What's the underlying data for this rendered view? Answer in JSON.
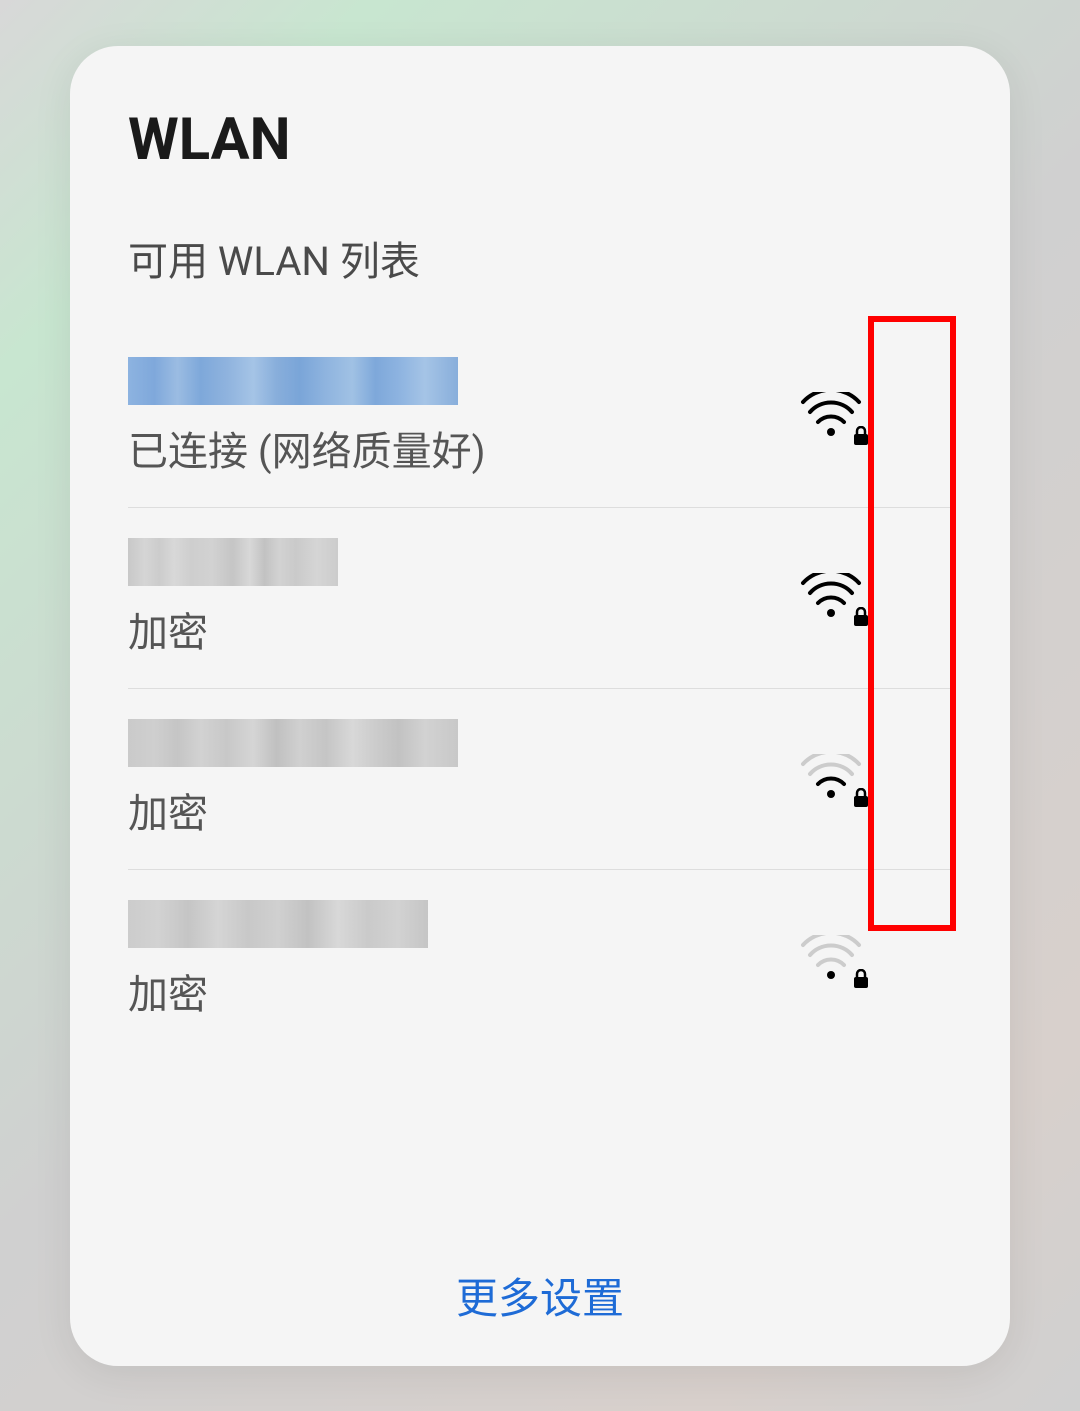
{
  "title": "WLAN",
  "subtitle": "可用 WLAN 列表",
  "networks": [
    {
      "status": "已连接 (网络质量好)",
      "signal": "strong",
      "locked": true,
      "nameStyle": "pixelated-blue"
    },
    {
      "status": "加密",
      "signal": "strong",
      "locked": true,
      "nameStyle": "pixelated-gray1"
    },
    {
      "status": "加密",
      "signal": "medium",
      "locked": true,
      "nameStyle": "pixelated-gray2"
    },
    {
      "status": "加密",
      "signal": "weak",
      "locked": true,
      "nameStyle": "pixelated-gray3"
    }
  ],
  "moreSettings": "更多设置"
}
